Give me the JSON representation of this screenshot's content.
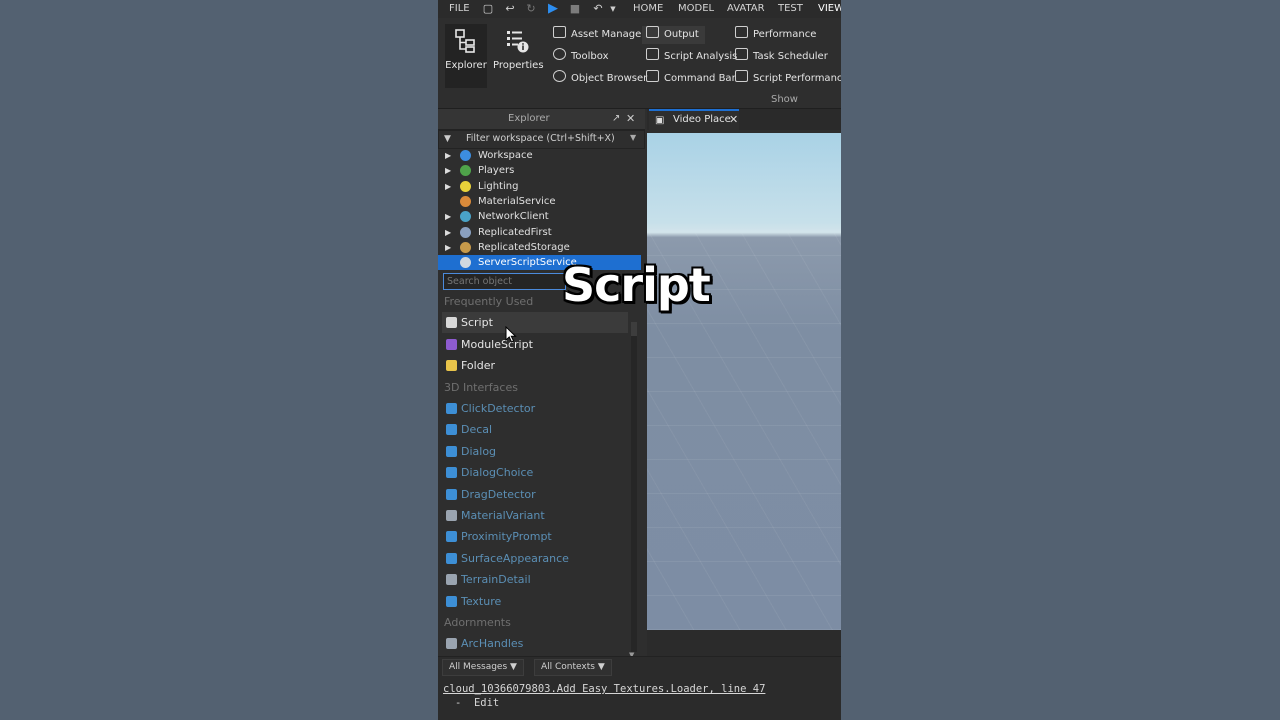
{
  "menubar": {
    "file": "FILE",
    "tabs": [
      "HOME",
      "MODEL",
      "AVATAR",
      "TEST",
      "VIEW"
    ]
  },
  "ribbon": {
    "explorer": "Explorer",
    "properties": "Properties",
    "col1": [
      "Asset Manager",
      "Toolbox",
      "Object Browser"
    ],
    "col2": [
      "Output",
      "Script Analysis",
      "Command Bar"
    ],
    "col3": [
      "Performance",
      "Task Scheduler",
      "Script Performance"
    ],
    "group_label": "Show"
  },
  "explorer": {
    "title": "Explorer",
    "filter_placeholder": "Filter workspace (Ctrl+Shift+X)",
    "tree": [
      {
        "label": "Workspace",
        "expandable": true,
        "color": "#3c8de0"
      },
      {
        "label": "Players",
        "expandable": true,
        "color": "#4fa34a"
      },
      {
        "label": "Lighting",
        "expandable": true,
        "color": "#e8d23a"
      },
      {
        "label": "MaterialService",
        "expandable": false,
        "color": "#d98a3a"
      },
      {
        "label": "NetworkClient",
        "expandable": true,
        "color": "#4aa3c7"
      },
      {
        "label": "ReplicatedFirst",
        "expandable": true,
        "color": "#8aa0c0"
      },
      {
        "label": "ReplicatedStorage",
        "expandable": true,
        "color": "#c79a4a"
      },
      {
        "label": "ServerScriptService",
        "expandable": false,
        "color": "#d0d8e0",
        "selected": true
      }
    ]
  },
  "insert_menu": {
    "search_placeholder": "Search object",
    "sections": {
      "frequent": "Frequently Used",
      "interfaces": "3D Interfaces",
      "adornments": "Adornments"
    },
    "frequent": [
      "Script",
      "ModuleScript",
      "Folder"
    ],
    "interfaces": [
      "ClickDetector",
      "Decal",
      "Dialog",
      "DialogChoice",
      "DragDetector",
      "MaterialVariant",
      "ProximityPrompt",
      "SurfaceAppearance",
      "TerrainDetail",
      "Texture"
    ],
    "adornments": [
      "ArcHandles"
    ]
  },
  "viewport_tab": {
    "label": "Video Place"
  },
  "output": {
    "filter_messages": "All Messages",
    "filter_contexts": "All Contexts",
    "line1": "cloud_10366079803.Add Easy Textures.Loader, line 47",
    "line2": "-  Edit"
  },
  "caption": "Script"
}
